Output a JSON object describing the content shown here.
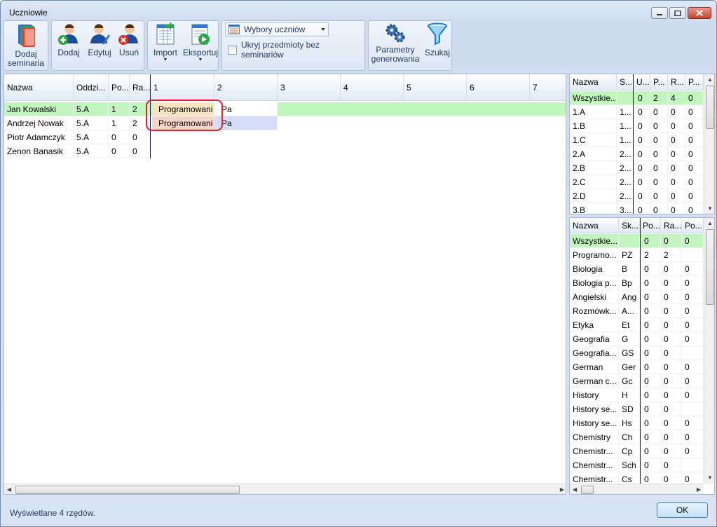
{
  "window": {
    "title": "Uczniowie"
  },
  "toolbar": {
    "add_seminars": "Dodaj seminaria",
    "add": "Dodaj",
    "edit": "Edytuj",
    "delete": "Usuń",
    "import": "Import",
    "export": "Eksportuj",
    "student_choices": "Wybory uczniów",
    "hide_subjects": "Ukryj przedmioty bez seminariów",
    "gen_params": "Parametry generowania",
    "search": "Szukaj"
  },
  "students": {
    "columns": [
      "Nazwa",
      "Oddzi...",
      "Po...",
      "Ra...",
      "1",
      "2",
      "3",
      "4",
      "5",
      "6",
      "7"
    ],
    "rows": [
      {
        "name": "Jan Kowalski",
        "class": "5.A",
        "po": "1",
        "ra": "2",
        "c1": "Programowani",
        "c2": "Pa"
      },
      {
        "name": "Andrzej Nowak",
        "class": "5.A",
        "po": "1",
        "ra": "2",
        "c1": "Programowani",
        "c2": "Pa"
      },
      {
        "name": "Piotr Adamczyk",
        "class": "5.A",
        "po": "0",
        "ra": "0",
        "c1": "",
        "c2": ""
      },
      {
        "name": "Zenon Banasik",
        "class": "5.A",
        "po": "0",
        "ra": "0",
        "c1": "",
        "c2": ""
      }
    ]
  },
  "classes": {
    "columns": [
      "Nazwa",
      "S...",
      "U...",
      "P...",
      "R...",
      "P..."
    ],
    "rows": [
      [
        "Wszystkie...",
        "",
        "0",
        "2",
        "4",
        "0"
      ],
      [
        "1.A",
        "1...",
        "0",
        "0",
        "0",
        "0"
      ],
      [
        "1.B",
        "1...",
        "0",
        "0",
        "0",
        "0"
      ],
      [
        "1.C",
        "1...",
        "0",
        "0",
        "0",
        "0"
      ],
      [
        "2.A",
        "2...",
        "0",
        "0",
        "0",
        "0"
      ],
      [
        "2.B",
        "2...",
        "0",
        "0",
        "0",
        "0"
      ],
      [
        "2.C",
        "2...",
        "0",
        "0",
        "0",
        "0"
      ],
      [
        "2.D",
        "2...",
        "0",
        "0",
        "0",
        "0"
      ],
      [
        "3.B",
        "3...",
        "0",
        "0",
        "0",
        "0"
      ]
    ]
  },
  "subjects": {
    "columns": [
      "Nazwa",
      "Sk...",
      "Po...",
      "Ra...",
      "Po..."
    ],
    "rows": [
      [
        "Wszystkie...",
        "",
        "0",
        "0",
        "0"
      ],
      [
        "Programo...",
        "PZ",
        "2",
        "2",
        ""
      ],
      [
        "Biologia",
        "B",
        "0",
        "0",
        "0"
      ],
      [
        "Biologia p...",
        "Bp",
        "0",
        "0",
        "0"
      ],
      [
        "Angielski",
        "Ang",
        "0",
        "0",
        "0"
      ],
      [
        "Rozmówk...",
        "A...",
        "0",
        "0",
        "0"
      ],
      [
        "Etyka",
        "Et",
        "0",
        "0",
        "0"
      ],
      [
        "Geografia",
        "G",
        "0",
        "0",
        "0"
      ],
      [
        "Geografia...",
        "GS",
        "0",
        "0",
        ""
      ],
      [
        "German",
        "Ger",
        "0",
        "0",
        "0"
      ],
      [
        "German c...",
        "Gc",
        "0",
        "0",
        "0"
      ],
      [
        "History",
        "H",
        "0",
        "0",
        "0"
      ],
      [
        "History se...",
        "SD",
        "0",
        "0",
        ""
      ],
      [
        "History se...",
        "Hs",
        "0",
        "0",
        "0"
      ],
      [
        "Chemistry",
        "Ch",
        "0",
        "0",
        "0"
      ],
      [
        "Chemistr...",
        "Cp",
        "0",
        "0",
        "0"
      ],
      [
        "Chemistr...",
        "Sch",
        "0",
        "0",
        ""
      ],
      [
        "Chemistr...",
        "Cs",
        "0",
        "0",
        "0"
      ]
    ]
  },
  "status": {
    "text": "Wyświetlane 4 rzędów.",
    "ok": "OK"
  },
  "colors": {
    "selected_row": "#c3f5bf",
    "slot_highlight": "#f7d4c8",
    "slot_alt": "#d4dcf7",
    "circle": "#e0202a"
  }
}
